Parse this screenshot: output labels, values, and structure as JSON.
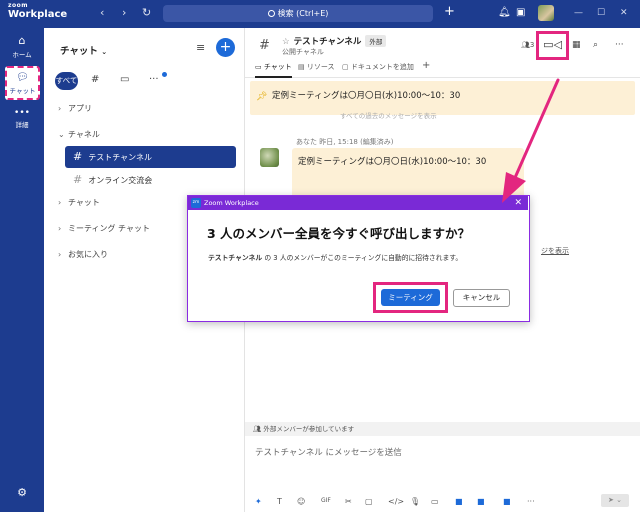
{
  "app": {
    "logo_top": "zoom",
    "logo_bottom": "Workplace",
    "search_text": "検索 (Ctrl+E)"
  },
  "rail": {
    "home_label": "ホーム",
    "chat_label": "チャット",
    "more_label": "詳細"
  },
  "sidebar": {
    "title": "チャット",
    "tab_all": "すべて",
    "sections": {
      "apps": "アプリ",
      "channels": "チャネル",
      "chat": "チャット",
      "meeting_chat": "ミーティング チャット",
      "favorites": "お気に入り"
    },
    "channels": [
      {
        "name": "テストチャンネル"
      },
      {
        "name": "オンライン交流会"
      }
    ]
  },
  "channel": {
    "name": "テストチャンネル",
    "badge": "外部",
    "subtitle": "公開チャネル",
    "member_count": "3",
    "tabs": [
      "チャット",
      "リソース",
      "ドキュメントを追加"
    ],
    "pinned_text": "定例ミーティングは〇月〇日(水)10:00～10：30",
    "faded_text": "すべての過去のメッセージを表示",
    "message": {
      "meta": "あなた 昨日, 15:18 (編集済み)",
      "text": "定例ミーティングは〇月〇日(水)10:00～10：30"
    },
    "show_more": "ジを表示",
    "external_notice": "外部メンバーが参加しています",
    "compose_placeholder": "テストチャンネル にメッセージを送信"
  },
  "dialog": {
    "window_title": "Zoom Workplace",
    "heading": "3 人のメンバー全員を今すぐ呼び出しますか？",
    "desc_channel": "テストチャンネル",
    "desc_rest": " の 3 人のメンバーがこのミーティングに自動的に招待されます。",
    "meeting_button": "ミーティング",
    "cancel_button": "キャンセル"
  },
  "colors": {
    "brand": "#1d3c8f",
    "accent_blue": "#1d6ad8",
    "highlight_pink": "#e3267f",
    "dialog_purple": "#7a2ad6",
    "pinned_bg": "#fdf0d6"
  }
}
